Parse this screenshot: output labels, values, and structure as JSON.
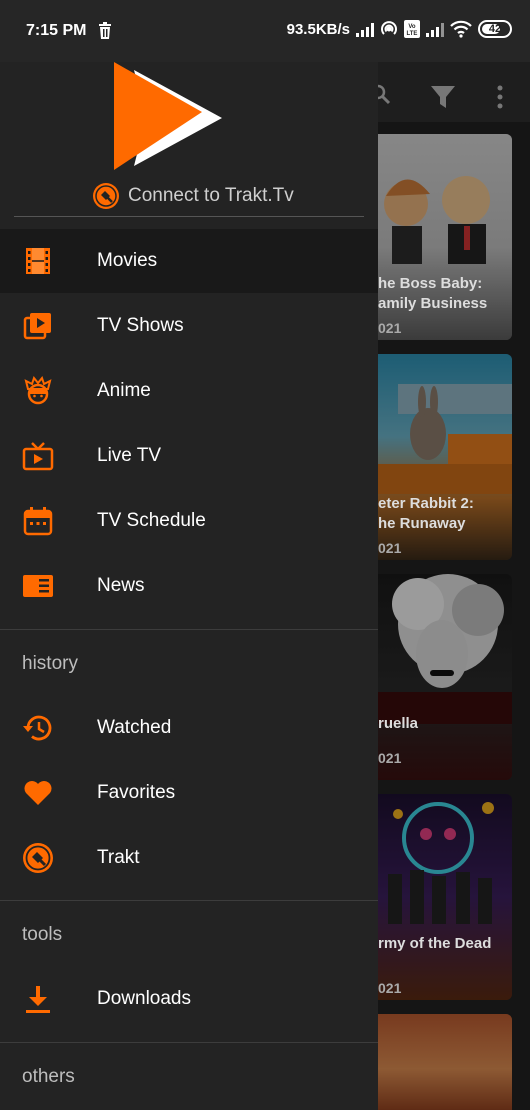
{
  "status_bar": {
    "time": "7:15 PM",
    "network_speed": "93.5KB/s",
    "battery": "42"
  },
  "drawer": {
    "connect_label": "Connect to Trakt.Tv",
    "main_items": [
      {
        "label": "Movies",
        "icon": "film-icon",
        "active": true
      },
      {
        "label": "TV Shows",
        "icon": "tv-shows-icon"
      },
      {
        "label": "Anime",
        "icon": "anime-icon"
      },
      {
        "label": "Live TV",
        "icon": "live-tv-icon"
      },
      {
        "label": "TV Schedule",
        "icon": "calendar-icon"
      },
      {
        "label": "News",
        "icon": "news-icon"
      }
    ],
    "history_heading": "history",
    "history_items": [
      {
        "label": "Watched",
        "icon": "history-icon"
      },
      {
        "label": "Favorites",
        "icon": "heart-icon"
      },
      {
        "label": "Trakt",
        "icon": "trakt-icon"
      }
    ],
    "tools_heading": "tools",
    "tools_items": [
      {
        "label": "Downloads",
        "icon": "download-icon"
      }
    ],
    "others_heading": "others"
  },
  "background": {
    "posters": [
      {
        "title": "he Boss Baby:\namily Business",
        "year": "021"
      },
      {
        "title": "eter Rabbit 2:\nhe Runaway",
        "year": "021"
      },
      {
        "title": "ruella",
        "year": "021"
      },
      {
        "title": "rmy of the Dead",
        "year": "021"
      }
    ]
  },
  "colors": {
    "accent": "#ff6a00",
    "drawer_bg": "#232323",
    "active_bg": "#191919"
  }
}
